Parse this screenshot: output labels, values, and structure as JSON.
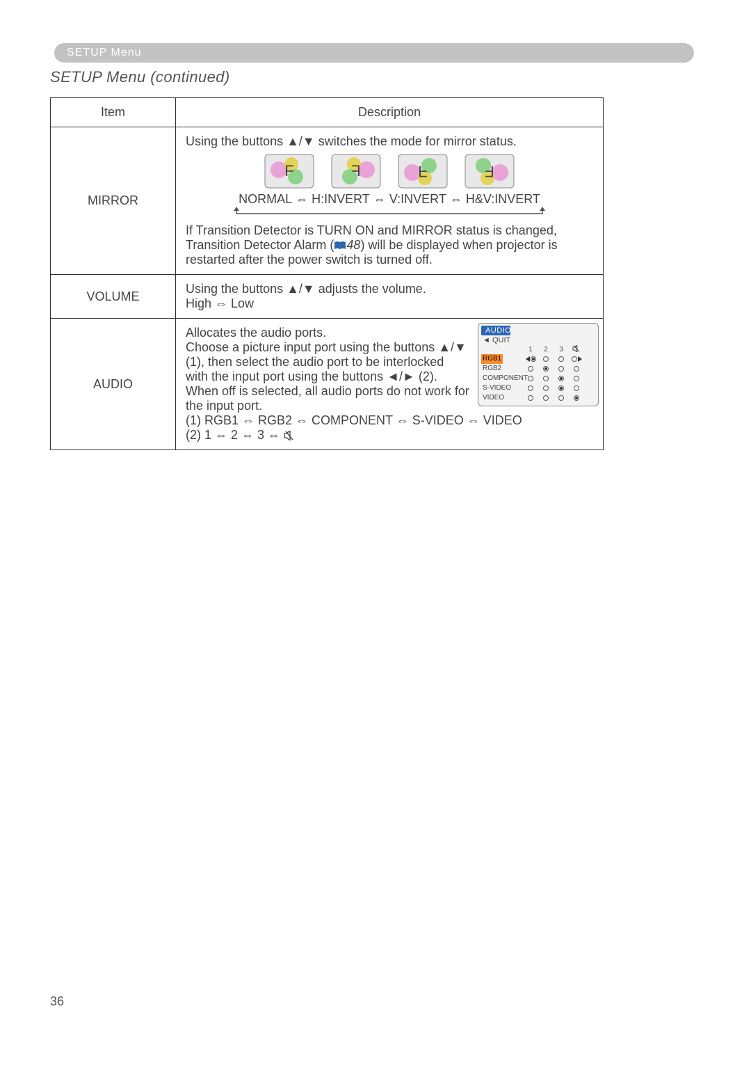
{
  "header": {
    "section_label": "SETUP Menu",
    "subtitle": "SETUP Menu (continued)"
  },
  "table": {
    "header_item": "Item",
    "header_desc": "Description"
  },
  "mirror": {
    "label": "MIRROR",
    "line1_a": "Using the buttons ",
    "line1_b": " switches the mode for mirror status.",
    "arrows_ud": "▲/▼",
    "mode_normal": "NORMAL",
    "mode_hinv": "H:INVERT",
    "mode_vinv": "V:INVERT",
    "mode_hvinv": "H&V:INVERT",
    "sep": " ⇔ ",
    "note_a": "If Transition Detector is TURN ON and MIRROR status is changed, Transition Detector Alarm (",
    "note_pg": "48",
    "note_b": ") will be displayed when projector is restarted after the power switch is turned off."
  },
  "volume": {
    "label": "VOLUME",
    "line1_a": "Using the buttons ",
    "line1_b": " adjusts the volume.",
    "arrows_ud": "▲/▼",
    "line2": "  High ⇔ Low"
  },
  "audio": {
    "label": "AUDIO",
    "p1_a": "Allocates the audio ports.",
    "p1_b": "Choose a picture input port using the buttons ",
    "arrows_ud": "▲/▼",
    "p1_c": " (1), then select the audio port to be interlocked with the input port using the buttons ",
    "arrows_lr": "◄/►",
    "p1_d": " (2). When off is selected, all audio ports do not work for the input port.",
    "list1": "(1)  RGB1 ⇔ RGB2 ⇔ COMPONENT ⇔ S-VIDEO ⇔ VIDEO",
    "list2": "(2)  1 ⇔ 2 ⇔ 3 ⇔ ",
    "panel": {
      "title": "AUDIO",
      "quit": "◄ QUIT",
      "cols": {
        "c1": "1",
        "c2": "2",
        "c3": "3"
      },
      "rows": {
        "rgb1": "RGB1",
        "rgb2": "RGB2",
        "component": "COMPONENT",
        "svideo": "S-VIDEO",
        "video": "VIDEO"
      }
    }
  },
  "page_number": "36"
}
